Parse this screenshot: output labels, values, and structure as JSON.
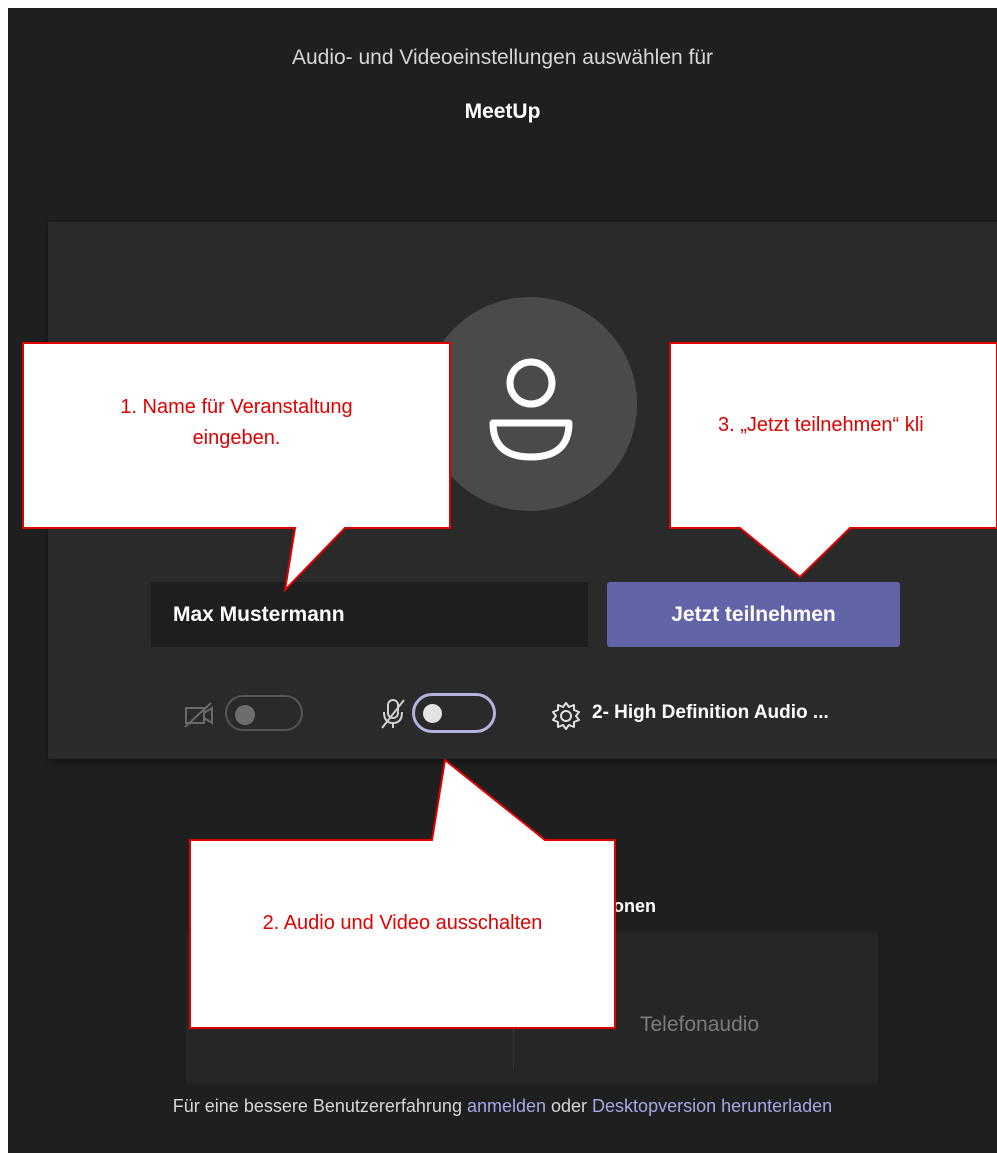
{
  "header": {
    "title": "Audio- und Videoeinstellungen auswählen für",
    "meeting_name": "MeetUp"
  },
  "prejoin": {
    "name_value": "Max Mustermann",
    "join_label": "Jetzt teilnehmen",
    "device_label": "2- High Definition Audio ...",
    "video_enabled": false,
    "audio_enabled": false,
    "accent_color": "#6264a7"
  },
  "other_options": {
    "heading_partial": "ionen",
    "phone_audio_label": "Telefonaudio",
    "left_option_partial": ""
  },
  "footer": {
    "prefix": "Für eine bessere Benutzererfahrung ",
    "signin_link": "anmelden",
    "middle": " oder ",
    "download_link": "Desktopversion herunterladen"
  },
  "annotations": {
    "step1_line1": "1. Name für Veranstaltung",
    "step1_line2": "eingeben.",
    "step2": "2. Audio und Video ausschalten",
    "step3": "3. „Jetzt teilnehmen“ kli",
    "callout_border_color": "#e00000"
  },
  "icons": {
    "video": "video-off-icon",
    "mic": "mic-off-icon",
    "settings": "gear-icon",
    "avatar": "person-icon"
  }
}
